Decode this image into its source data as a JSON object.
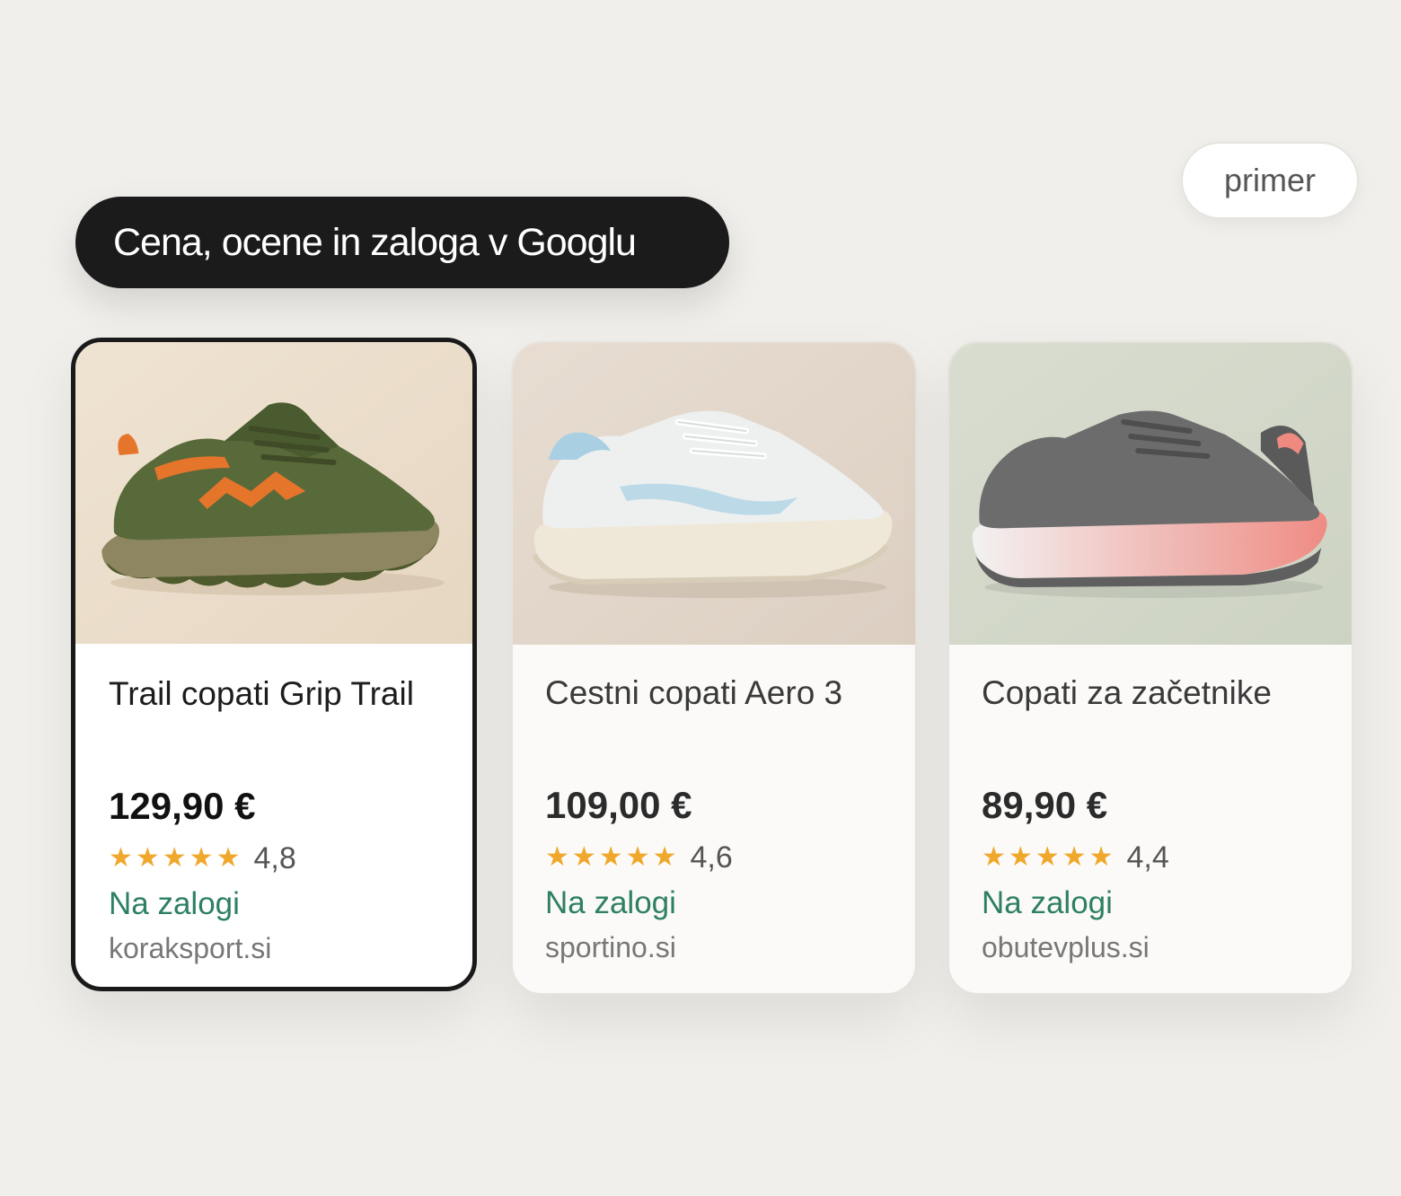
{
  "badge": {
    "label": "primer"
  },
  "header": {
    "title": "Cena, ocene in zaloga v Googlu"
  },
  "products": [
    {
      "title": "Trail copati Grip Trail",
      "price": "129,90 €",
      "stars": "★★★★★",
      "rating": "4,8",
      "stock": "Na zalogi",
      "shop": "koraksport.si",
      "image_icon": "trail-shoe-icon",
      "selected": true
    },
    {
      "title": "Cestni copati Aero 3",
      "price": "109,00 €",
      "stars": "★★★★★",
      "rating": "4,6",
      "stock": "Na zalogi",
      "shop": "sportino.si",
      "image_icon": "road-shoe-icon",
      "selected": false
    },
    {
      "title": "Copati za začetnike",
      "price": "89,90 €",
      "stars": "★★★★★",
      "rating": "4,4",
      "stock": "Na zalogi",
      "shop": "obutevplus.si",
      "image_icon": "beginner-shoe-icon",
      "selected": false
    }
  ],
  "colors": {
    "background": "#f0efeb",
    "title_pill": "#1b1b1b",
    "star": "#f0a82c",
    "in_stock": "#2e8063",
    "selected_border": "#1a1a1a"
  }
}
